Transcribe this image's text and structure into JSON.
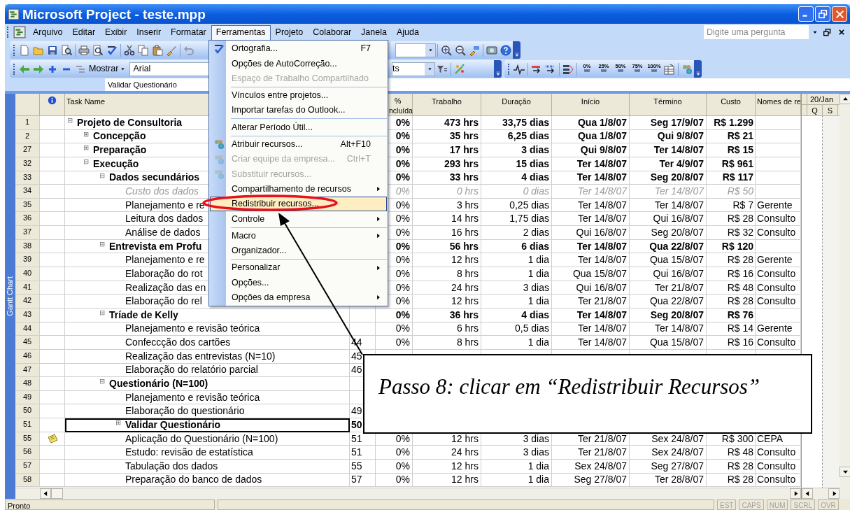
{
  "window": {
    "title": "Microsoft Project - teste.mpp"
  },
  "menu_bar": {
    "items": [
      {
        "label": "Arquivo",
        "selected": false
      },
      {
        "label": "Editar",
        "selected": false
      },
      {
        "label": "Exibir",
        "selected": false
      },
      {
        "label": "Inserir",
        "selected": false
      },
      {
        "label": "Formatar",
        "selected": false
      },
      {
        "label": "Ferramentas",
        "selected": true
      },
      {
        "label": "Projeto",
        "selected": false
      },
      {
        "label": "Colaborar",
        "selected": false
      },
      {
        "label": "Janela",
        "selected": false
      },
      {
        "label": "Ajuda",
        "selected": false
      }
    ],
    "question_placeholder": "Digite uma pergunta"
  },
  "toolbar": {
    "show_button": "Mostrar",
    "font_field": "Arial",
    "filter_field": "ts",
    "progress_buttons": [
      "0%",
      "25%",
      "50%",
      "75%",
      "100%"
    ]
  },
  "entry_bar": {
    "value": "Validar Questionário"
  },
  "view_bar": {
    "label": "Gantt Chart"
  },
  "column_headers": {
    "task_name": "Task Name",
    "percent_complete": [
      "%",
      "ncluída"
    ],
    "work": "Trabalho",
    "duration": "Duração",
    "start": "Início",
    "finish": "Término",
    "cost": "Custo",
    "resource_names": "Nomes de re"
  },
  "timescale": {
    "top": "20/Jan",
    "days": [
      "Q",
      "S"
    ]
  },
  "rows": [
    {
      "id": "1",
      "name": "Projeto de Consultoria",
      "kind": "summary",
      "expanded": true,
      "selected": false,
      "note": false,
      "percent_complete": "0%",
      "work": "473 hrs",
      "duration": "33,75 dias",
      "start": "Qua 1/8/07",
      "finish": "Seg 17/9/07",
      "cost": "R$ 1.299",
      "children": [
        {
          "id": "2",
          "name": "Concepção",
          "kind": "summary",
          "expanded": false,
          "selected": false,
          "note": false,
          "percent_complete": "0%",
          "work": "35 hrs",
          "duration": "6,25 dias",
          "start": "Qua 1/8/07",
          "finish": "Qui 9/8/07",
          "cost": "R$ 21"
        },
        {
          "id": "27",
          "name": "Preparação",
          "kind": "summary",
          "expanded": false,
          "selected": false,
          "note": false,
          "percent_complete": "0%",
          "work": "17 hrs",
          "duration": "3 dias",
          "start": "Qui 9/8/07",
          "finish": "Ter 14/8/07",
          "cost": "R$ 15"
        },
        {
          "id": "32",
          "name": "Execução",
          "kind": "summary",
          "expanded": true,
          "selected": false,
          "note": false,
          "percent_complete": "0%",
          "work": "293 hrs",
          "duration": "15 dias",
          "start": "Ter 14/8/07",
          "finish": "Ter 4/9/07",
          "cost": "R$ 961",
          "children": [
            {
              "id": "33",
              "name": "Dados secundários",
              "kind": "summary",
              "expanded": true,
              "selected": false,
              "note": false,
              "percent_complete": "0%",
              "work": "33 hrs",
              "duration": "4 dias",
              "start": "Ter 14/8/07",
              "finish": "Seg 20/8/07",
              "cost": "R$ 117",
              "children": [
                {
                  "id": "34",
                  "name": "Custo dos dados",
                  "kind": "inactive",
                  "selected": false,
                  "note": false,
                  "percent_complete": "0%",
                  "work": "0 hrs",
                  "duration": "0 dias",
                  "start": "Ter 14/8/07",
                  "finish": "Ter 14/8/07",
                  "cost": "R$ 50"
                },
                {
                  "id": "35",
                  "name": "Planejamento e re",
                  "kind": "task",
                  "selected": false,
                  "note": false,
                  "percent_complete": "0%",
                  "work": "3 hrs",
                  "duration": "0,25 dias",
                  "start": "Ter 14/8/07",
                  "finish": "Ter 14/8/07",
                  "cost": "R$ 7",
                  "resource_names": "Gerente"
                },
                {
                  "id": "36",
                  "name": "Leitura dos dados",
                  "kind": "task",
                  "selected": false,
                  "note": false,
                  "percent_complete": "0%",
                  "work": "14 hrs",
                  "duration": "1,75 dias",
                  "start": "Ter 14/8/07",
                  "finish": "Qui 16/8/07",
                  "cost": "R$ 28",
                  "resource_names": "Consulto"
                },
                {
                  "id": "37",
                  "name": "Análise de dados",
                  "kind": "task",
                  "selected": false,
                  "note": false,
                  "percent_complete": "0%",
                  "work": "16 hrs",
                  "duration": "2 dias",
                  "start": "Qui 16/8/07",
                  "finish": "Seg 20/8/07",
                  "cost": "R$ 32",
                  "resource_names": "Consulto"
                }
              ]
            },
            {
              "id": "38",
              "name": "Entrevista em Profu",
              "kind": "summary",
              "expanded": true,
              "selected": false,
              "note": false,
              "percent_complete": "0%",
              "work": "56 hrs",
              "duration": "6 dias",
              "start": "Ter 14/8/07",
              "finish": "Qua 22/8/07",
              "cost": "R$ 120",
              "children": [
                {
                  "id": "39",
                  "name": "Planejamento e re",
                  "kind": "task",
                  "selected": false,
                  "note": false,
                  "percent_complete": "0%",
                  "work": "12 hrs",
                  "duration": "1 dia",
                  "start": "Ter 14/8/07",
                  "finish": "Qua 15/8/07",
                  "cost": "R$ 28",
                  "resource_names": "Gerente"
                },
                {
                  "id": "40",
                  "name": "Elaboração do rot",
                  "kind": "task",
                  "selected": false,
                  "note": false,
                  "percent_complete": "0%",
                  "work": "8 hrs",
                  "duration": "1 dia",
                  "start": "Qua 15/8/07",
                  "finish": "Qui 16/8/07",
                  "cost": "R$ 16",
                  "resource_names": "Consulto"
                },
                {
                  "id": "41",
                  "name": "Realização das en",
                  "kind": "task",
                  "selected": false,
                  "note": false,
                  "percent_complete": "0%",
                  "work": "24 hrs",
                  "duration": "3 dias",
                  "start": "Qui 16/8/07",
                  "finish": "Ter 21/8/07",
                  "cost": "R$ 48",
                  "resource_names": "Consulto"
                },
                {
                  "id": "42",
                  "name": "Elaboração do rel",
                  "kind": "task",
                  "selected": false,
                  "note": false,
                  "percent_complete": "0%",
                  "work": "12 hrs",
                  "duration": "1 dia",
                  "start": "Ter 21/8/07",
                  "finish": "Qua 22/8/07",
                  "cost": "R$ 28",
                  "resource_names": "Consulto"
                }
              ]
            },
            {
              "id": "43",
              "name": "Tríade de Kelly",
              "kind": "summary",
              "expanded": true,
              "selected": false,
              "note": false,
              "percent_complete": "0%",
              "work": "36 hrs",
              "duration": "4 dias",
              "start": "Ter 14/8/07",
              "finish": "Seg 20/8/07",
              "cost": "R$ 76",
              "children": [
                {
                  "id": "44",
                  "name": "Planejamento e revisão teórica",
                  "kind": "task",
                  "selected": false,
                  "note": false,
                  "percent_complete": "0%",
                  "work": "6 hrs",
                  "duration": "0,5 dias",
                  "start": "Ter 14/8/07",
                  "finish": "Ter 14/8/07",
                  "cost": "R$ 14",
                  "resource_names": "Gerente"
                },
                {
                  "id": "45",
                  "name": "Confeccção dos cartões",
                  "kind": "task",
                  "selected": false,
                  "note": false,
                  "predecessors": "44",
                  "percent_complete": "0%",
                  "work": "8 hrs",
                  "duration": "1 dia",
                  "start": "Ter 14/8/07",
                  "finish": "Qua 15/8/07",
                  "cost": "R$ 16",
                  "resource_names": "Consulto"
                },
                {
                  "id": "46",
                  "name": "Realização das entrevistas (N=10)",
                  "kind": "task",
                  "selected": false,
                  "note": false,
                  "predecessors": "45"
                },
                {
                  "id": "47",
                  "name": "Elaboração do relatório parcial",
                  "kind": "task",
                  "selected": false,
                  "note": false,
                  "predecessors": "46"
                }
              ]
            },
            {
              "id": "48",
              "name": "Questionário (N=100)",
              "kind": "summary",
              "expanded": true,
              "selected": false,
              "note": false,
              "children": [
                {
                  "id": "49",
                  "name": "Planejamento e revisão teórica",
                  "kind": "task",
                  "selected": false,
                  "note": false
                },
                {
                  "id": "50",
                  "name": "Elaboração do questionário",
                  "kind": "task",
                  "selected": false,
                  "note": false,
                  "predecessors": "49"
                },
                {
                  "id": "51",
                  "name": "Validar Questionário",
                  "kind": "summary",
                  "expanded": false,
                  "selected": true,
                  "note": false,
                  "predecessors": "50"
                },
                {
                  "id": "55",
                  "name": "Aplicação do Questionário (N=100)",
                  "kind": "task",
                  "selected": false,
                  "note": true,
                  "predecessors": "51",
                  "percent_complete": "0%",
                  "work": "12 hrs",
                  "duration": "3 dias",
                  "start": "Ter 21/8/07",
                  "finish": "Sex 24/8/07",
                  "cost": "R$ 300",
                  "resource_names": "CEPA"
                },
                {
                  "id": "56",
                  "name": "Estudo: revisão de estatística",
                  "kind": "task",
                  "selected": false,
                  "note": false,
                  "predecessors": "51",
                  "percent_complete": "0%",
                  "work": "24 hrs",
                  "duration": "3 dias",
                  "start": "Ter 21/8/07",
                  "finish": "Sex 24/8/07",
                  "cost": "R$ 48",
                  "resource_names": "Consulto"
                },
                {
                  "id": "57",
                  "name": "Tabulação dos dados",
                  "kind": "task",
                  "selected": false,
                  "note": false,
                  "predecessors": "55",
                  "percent_complete": "0%",
                  "work": "12 hrs",
                  "duration": "1 dia",
                  "start": "Sex 24/8/07",
                  "finish": "Seg 27/8/07",
                  "cost": "R$ 28",
                  "resource_names": "Consulto"
                },
                {
                  "id": "58",
                  "name": "Preparação do banco de dados",
                  "kind": "task",
                  "selected": false,
                  "note": false,
                  "predecessors": "57",
                  "percent_complete": "0%",
                  "work": "12 hrs",
                  "duration": "1 dia",
                  "start": "Seg 27/8/07",
                  "finish": "Ter 28/8/07",
                  "cost": "R$ 28",
                  "resource_names": "Consulto"
                }
              ]
            }
          ]
        }
      ]
    }
  ],
  "tools_menu": {
    "items": [
      {
        "kind": "item",
        "label": "Ortografia...",
        "shortcut": "F7",
        "disabled": false,
        "submenu": false,
        "selected": false
      },
      {
        "kind": "item",
        "label": "Opções de AutoCorreção...",
        "disabled": false,
        "submenu": false,
        "selected": false
      },
      {
        "kind": "item",
        "label": "Espaço de Trabalho Compartilhado",
        "disabled": true,
        "submenu": false,
        "selected": false
      },
      {
        "kind": "separator"
      },
      {
        "kind": "item",
        "label": "Vínculos entre projetos...",
        "disabled": false,
        "submenu": false,
        "selected": false
      },
      {
        "kind": "item",
        "label": "Importar tarefas do Outlook...",
        "disabled": false,
        "submenu": false,
        "selected": false
      },
      {
        "kind": "separator"
      },
      {
        "kind": "item",
        "label": "Alterar Período Útil...",
        "disabled": false,
        "submenu": false,
        "selected": false
      },
      {
        "kind": "separator"
      },
      {
        "kind": "item",
        "label": "Atribuir recursos...",
        "shortcut": "Alt+F10",
        "disabled": false,
        "submenu": false,
        "selected": false
      },
      {
        "kind": "item",
        "label": "Criar equipe da empresa...",
        "shortcut": "Ctrl+T",
        "disabled": true,
        "submenu": false,
        "selected": false
      },
      {
        "kind": "item",
        "label": "Substituir recursos...",
        "disabled": true,
        "submenu": false,
        "selected": false
      },
      {
        "kind": "item",
        "label": "Compartilhamento de recursos",
        "disabled": false,
        "submenu": true,
        "selected": false
      },
      {
        "kind": "item",
        "label": "Redistribuir recursos...",
        "disabled": false,
        "submenu": false,
        "selected": true
      },
      {
        "kind": "item",
        "label": "Controle",
        "disabled": false,
        "submenu": true,
        "selected": false
      },
      {
        "kind": "separator"
      },
      {
        "kind": "item",
        "label": "Macro",
        "disabled": false,
        "submenu": true,
        "selected": false
      },
      {
        "kind": "item",
        "label": "Organizador...",
        "disabled": false,
        "submenu": false,
        "selected": false
      },
      {
        "kind": "separator"
      },
      {
        "kind": "item",
        "label": "Personalizar",
        "disabled": false,
        "submenu": true,
        "selected": false
      },
      {
        "kind": "item",
        "label": "Opções...",
        "disabled": false,
        "submenu": false,
        "selected": false
      },
      {
        "kind": "item",
        "label": "Opções da empresa",
        "disabled": false,
        "submenu": true,
        "selected": false
      }
    ]
  },
  "callout": {
    "text": "Passo 8: clicar em “Redistribuir Recursos”"
  },
  "status_bar": {
    "text": "Pronto",
    "indicators": [
      {
        "label": "EST",
        "active": false
      },
      {
        "label": "CAPS",
        "active": false
      },
      {
        "label": "NUM",
        "active": false
      },
      {
        "label": "SCRL",
        "active": false
      },
      {
        "label": "OVR",
        "active": false
      }
    ]
  }
}
